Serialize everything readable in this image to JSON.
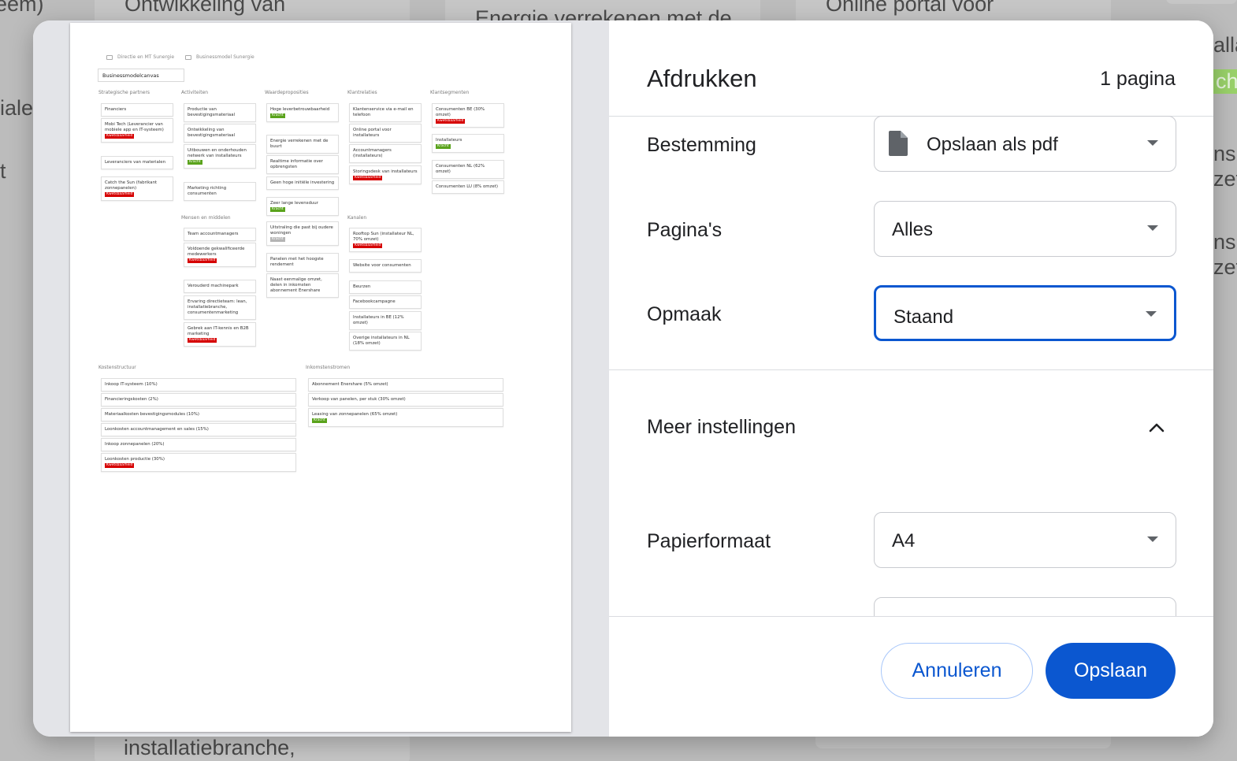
{
  "background": {
    "fragments": [
      "eem)",
      "Ontwikkeling van",
      "Energie verrekenen met de",
      "Online portal voor",
      "iale",
      "t",
      "alla",
      "cht",
      "nsu",
      "zet",
      "nsu",
      "zet",
      "installatiebranche,"
    ]
  },
  "dialog": {
    "title": "Afdrukken",
    "page_count": "1 pagina",
    "destination": {
      "label": "Bestemming",
      "value": "Opslaan als pdf",
      "icon": "file-icon"
    },
    "pages": {
      "label": "Pagina's",
      "value": "Alles"
    },
    "layout": {
      "label": "Opmaak",
      "value": "Staand"
    },
    "more_settings": {
      "label": "Meer instellingen",
      "icon": "chevron-up-icon"
    },
    "paper_size": {
      "label": "Papierformaat",
      "value": "A4"
    },
    "buttons": {
      "cancel": "Annuleren",
      "save": "Opslaan"
    },
    "colors": {
      "accent": "#0b57d0",
      "cancel_border": "#a8c7fa",
      "preview_bg": "#e3e4e8"
    }
  },
  "preview": {
    "breadcrumb": [
      "Directie en MT Sunergie",
      "Businessmodel Sunergie"
    ],
    "title": "Businessmodelcanvas",
    "tags": {
      "weak": "Kwetsbaarheid",
      "strong": "Kracht"
    },
    "columns": {
      "partners": "Strategische partners",
      "activities": "Activiteiten",
      "value": "Waardeproposities",
      "relations": "Klantrelaties",
      "segments": "Klantsegmenten",
      "resources": "Mensen en middelen",
      "channels": "Kanalen",
      "costs": "Kostenstructuur",
      "revenue": "Inkomstenstromen"
    },
    "partners": [
      "Financiers",
      "Mobi Tech (Leverancier van mobiele app en IT-systeem)",
      "Leveranciers van materialen",
      "Catch the Sun (fabrikant zonnepanelen)"
    ],
    "activities": [
      "Productie van bevestigingsmateriaal",
      "Ontwikkeling van bevestigingsmateriaal",
      "Uitbouwen en onderhouden netwerk van installateurs",
      "Marketing richting consumenten"
    ],
    "resources": [
      "Team accountmanagers",
      "Voldoende gekwalificeerde medewerkers",
      "Verouderd machinepark",
      "Ervaring directieteam: lean, installatiebranche, consumentenmarketing",
      "Gebrek aan IT-kennis en B2B marketing"
    ],
    "value": [
      "Hoge leverbetrouwbaarheid",
      "Energie verrekenen met de buurt",
      "Realtime informatie over opbrengsten",
      "Geen hoge initiële investering",
      "Zeer lange levensduur",
      "Uitstraling die past bij oudere woningen",
      "Panelen met het hoogste rendement",
      "Naast eenmalige omzet, delen in inkomsten abonnement Enershare"
    ],
    "relations": [
      "Klantenservice via e-mail en telefoon",
      "Online portal voor installateurs",
      "Accountmanagers (installateurs)",
      "Storingsdesk van installateurs"
    ],
    "channels": [
      "Rooftop Sun (installateur NL, 70% omzet)",
      "Website voor consumenten",
      "Beurzen",
      "Facebookcampagne",
      "Installateurs in BE (12% omzet)",
      "Overige installateurs in NL (18% omzet)"
    ],
    "segments": [
      "Consumenten BE (30% omzet)",
      "Installateurs",
      "Consumenten NL (62% omzet)",
      "Consumenten LU (8% omzet)"
    ],
    "costs": [
      "Inkoop IT-systeem (10%)",
      "Financieringskosten (2%)",
      "Materiaalkosten bevestigingsmodules (10%)",
      "Loonkosten accountmanagement en sales (15%)",
      "Inkoop zonnepanelen (20%)",
      "Loonkosten productie (30%)"
    ],
    "revenue": [
      "Abonnement Enershare (5% omzet)",
      "Verkoop van panelen, per stuk (30% omzet)",
      "Leasing van zonnepanelen (65% omzet)"
    ]
  }
}
